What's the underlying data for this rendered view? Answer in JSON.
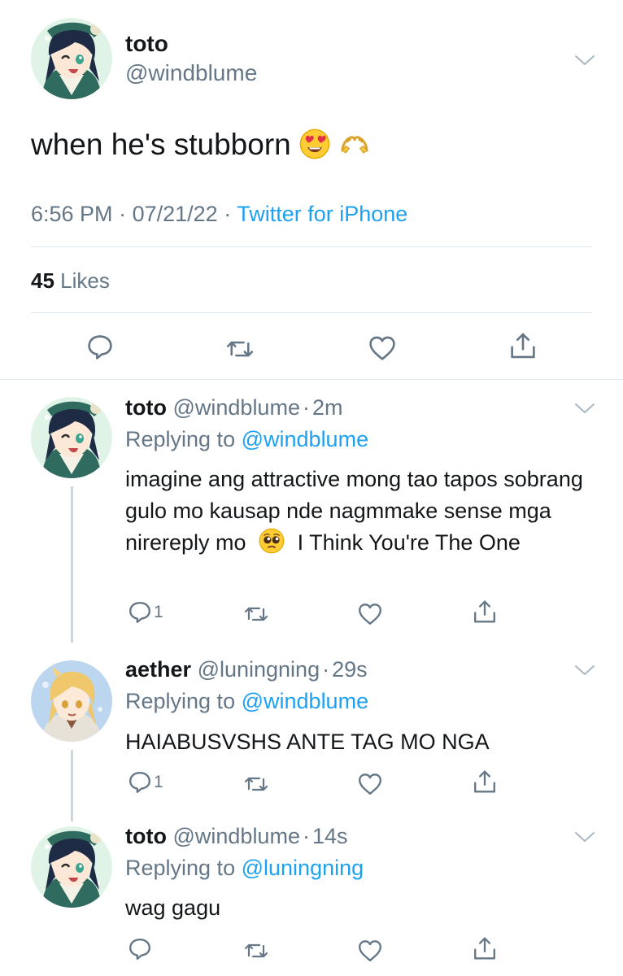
{
  "main_tweet": {
    "display_name": "toto",
    "handle": "@windblume",
    "text": "when he's stubborn",
    "emojis": [
      "heart-eyes-emoji",
      "heart-hands-emoji"
    ],
    "time": "6:56 PM",
    "date": "07/21/22",
    "separator": "·",
    "source": "Twitter for iPhone",
    "likes_count": "45",
    "likes_label": "Likes"
  },
  "replies": [
    {
      "display_name": "toto",
      "handle": "@windblume",
      "separator": "·",
      "time": "2m",
      "replying_prefix": "Replying to",
      "replying_to": "@windblume",
      "text_part1": "imagine ang attractive mong tao tapos sobrang gulo mo kausap nde nagmmake sense mga nirereply mo",
      "emoji": "pleading-face-emoji",
      "text_part2": "I Think You're The One",
      "reply_count": "1"
    },
    {
      "display_name": "aether",
      "handle": "@luningning",
      "separator": "·",
      "time": "29s",
      "replying_prefix": "Replying to",
      "replying_to": "@windblume",
      "text": "HAIABUSVSHS ANTE TAG MO NGA",
      "reply_count": "1"
    },
    {
      "display_name": "toto",
      "handle": "@windblume",
      "separator": "·",
      "time": "14s",
      "replying_prefix": "Replying to",
      "replying_to": "@luningning",
      "text": "wag gagu",
      "reply_count": ""
    }
  ],
  "colors": {
    "link": "#1da1f2",
    "secondary_text": "#657786",
    "primary_text": "#14171a",
    "divider": "#e1e8ed"
  },
  "icons": [
    "reply-icon",
    "retweet-icon",
    "like-icon",
    "share-icon",
    "chevron-down-icon"
  ]
}
